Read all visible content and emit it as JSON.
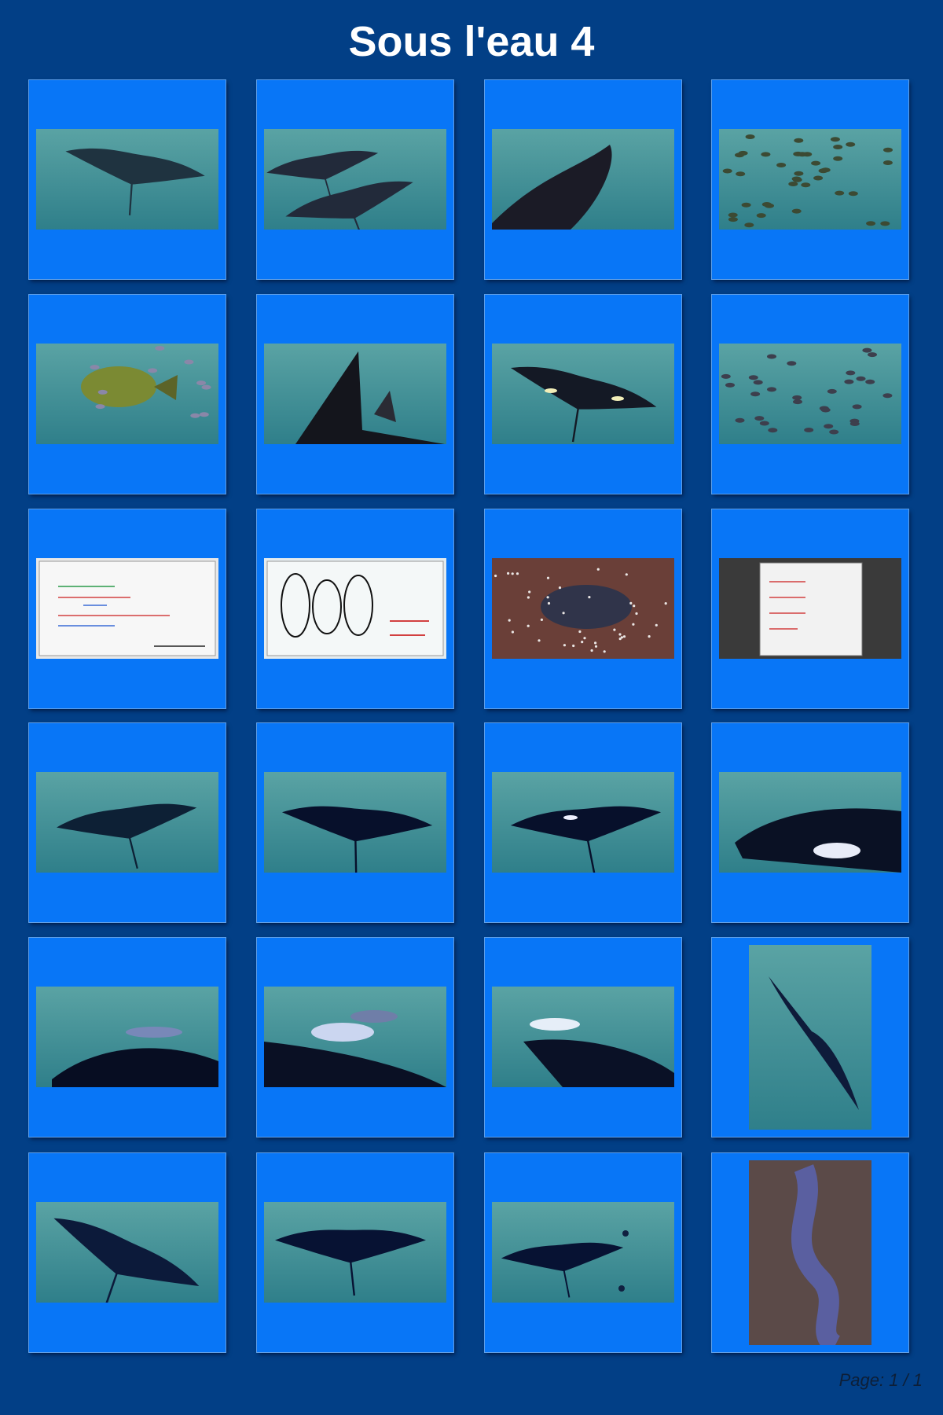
{
  "page": {
    "title": "Sous l'eau 4",
    "pager": "Page: 1 / 1"
  },
  "thumbnails": [
    {
      "subject": "manta-ray-green-water",
      "orientation": "landscape"
    },
    {
      "subject": "two-mantas-purple-water",
      "orientation": "landscape"
    },
    {
      "subject": "manta-wing-closeup",
      "orientation": "landscape"
    },
    {
      "subject": "school-of-fish",
      "orientation": "landscape"
    },
    {
      "subject": "jack-fish",
      "orientation": "landscape"
    },
    {
      "subject": "manta-fin-silhouette",
      "orientation": "landscape"
    },
    {
      "subject": "manta-with-remoras",
      "orientation": "landscape"
    },
    {
      "subject": "fish-school-purple",
      "orientation": "landscape"
    },
    {
      "subject": "whiteboard-schedule",
      "orientation": "landscape"
    },
    {
      "subject": "whiteboard-dive-map",
      "orientation": "landscape"
    },
    {
      "subject": "spotted-pufferfish",
      "orientation": "landscape"
    },
    {
      "subject": "whiteboard-in-salon",
      "orientation": "landscape"
    },
    {
      "subject": "manta-bright-blue",
      "orientation": "landscape"
    },
    {
      "subject": "manta-deep-blue",
      "orientation": "landscape"
    },
    {
      "subject": "manta-with-remoras-blue",
      "orientation": "landscape"
    },
    {
      "subject": "manta-belly-white-marks",
      "orientation": "landscape"
    },
    {
      "subject": "manta-remora-closeup",
      "orientation": "landscape"
    },
    {
      "subject": "remoras-on-manta",
      "orientation": "landscape"
    },
    {
      "subject": "remora-on-manta-head",
      "orientation": "landscape"
    },
    {
      "subject": "manta-vertical",
      "orientation": "portrait"
    },
    {
      "subject": "manta-backlit",
      "orientation": "landscape"
    },
    {
      "subject": "manta-with-small-fish",
      "orientation": "landscape"
    },
    {
      "subject": "manta-with-divers",
      "orientation": "landscape"
    },
    {
      "subject": "octopus-on-rock",
      "orientation": "portrait"
    }
  ]
}
